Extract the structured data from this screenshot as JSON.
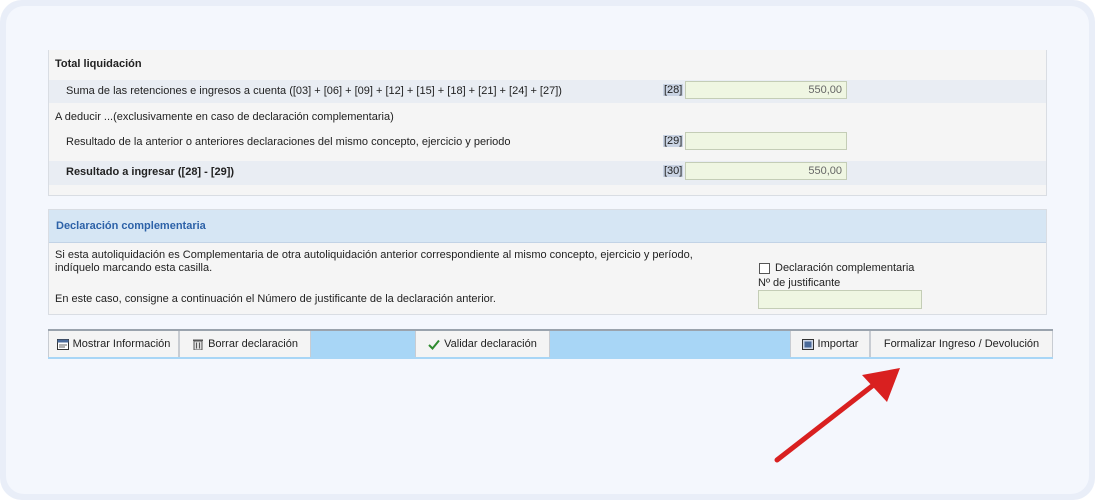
{
  "totals": {
    "title": "Total liquidación",
    "rows": [
      {
        "label": "Suma de las retenciones e ingresos a cuenta ([03] + [06] + [09] + [12] + [15] + [18] + [21] + [24] + [27])",
        "code": "[28]",
        "value": "550,00"
      },
      {
        "label": "Resultado de la anterior o anteriores declaraciones del mismo concepto, ejercicio y periodo",
        "code": "[29]",
        "value": ""
      },
      {
        "label": "Resultado a ingresar ([28] - [29])",
        "code": "[30]",
        "value": "550,00"
      }
    ],
    "deduct_label": "A deducir ...(exclusivamente en caso de declaración complementaria)"
  },
  "complementaria": {
    "title": "Declaración complementaria",
    "text1_line1": "Si esta autoliquidación es Complementaria de otra autoliquidación anterior correspondiente al mismo concepto, ejercicio y período,",
    "text1_line2": "indíquelo marcando esta casilla.",
    "text2": "En este caso, consigne a continuación el Número de justificante de la declaración anterior.",
    "checkbox_label": "Declaración complementaria",
    "justificante_label": "Nº de justificante",
    "justificante_value": ""
  },
  "toolbar": {
    "mostrar": "Mostrar Información",
    "borrar": "Borrar declaración",
    "validar": "Validar declaración",
    "importar": "Importar",
    "formalizar": "Formalizar Ingreso / Devolución"
  },
  "colors": {
    "annotation_arrow": "#d92020",
    "panel_header": "#d6e6f4",
    "toolbar_bg": "#a8d6f6"
  }
}
